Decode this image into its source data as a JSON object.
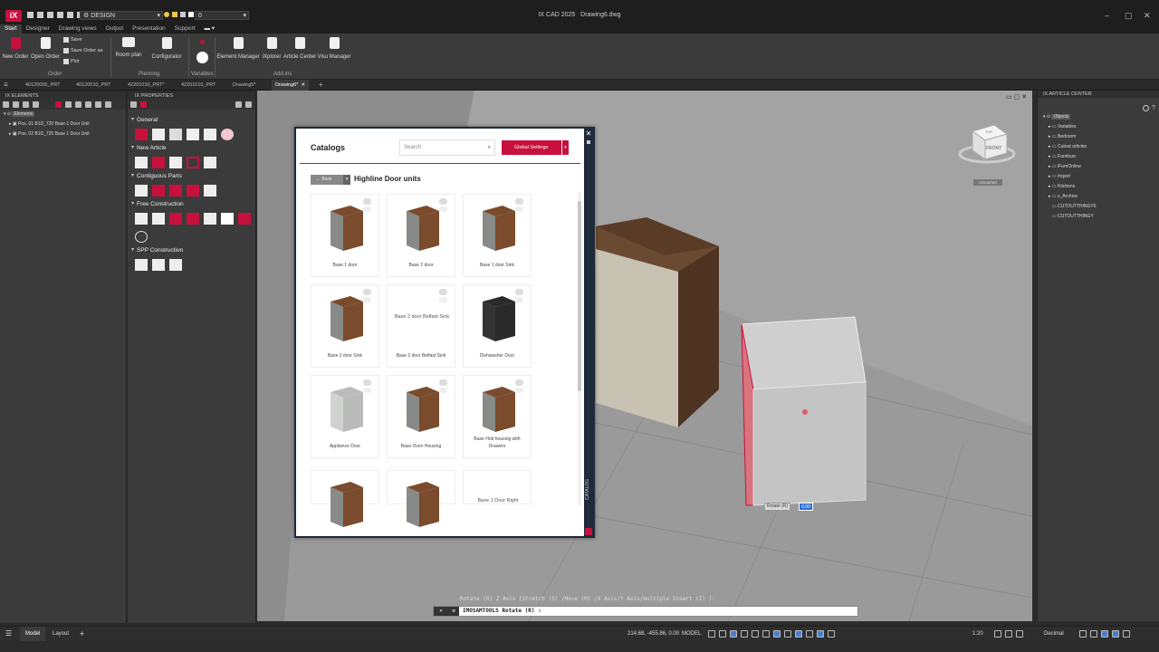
{
  "app": {
    "title": "IX CAD 2025",
    "document": "Drawing6.dwg",
    "workspace": "DESIGN",
    "layer": "0"
  },
  "ribbon_tabs": [
    "Start",
    "Designer",
    "Drawing views",
    "Output",
    "Presentation",
    "Support"
  ],
  "ribbon": {
    "new_order": "New Order",
    "open_order": "Open Order",
    "save": "Save",
    "save_order_as": "Save Order as",
    "plot": "Plot",
    "room_plan": "Room plan",
    "configurator": "Configurator",
    "element_manager": "Element Manager",
    "ixplorer": "iXplorer",
    "article_center": "Article Center",
    "visu_manager": "Visu Manager",
    "groups": {
      "order": "Order",
      "planning": "Planning",
      "variables": "Variables",
      "addins": "Add-ins"
    }
  },
  "doc_tabs": [
    "40120000_PRT",
    "40120010_PRT",
    "42201010_PRT*",
    "42201010_PRT",
    "Drawing5*",
    "Drawing6*"
  ],
  "elements_panel": {
    "title": "IX ELEMENTS",
    "root": "Elements",
    "items": [
      "Pos. 01 B1D_720 Base 1 Door Unit",
      "Pos. 02 B1D_720 Base 1 Door Unit"
    ]
  },
  "properties_panel": {
    "title": "IX PROPERTIES",
    "sections": [
      "General",
      "New Article",
      "Contiguous Parts",
      "Free Construction",
      "SPP Construction"
    ]
  },
  "article_center": {
    "title": "IX ARTICLE CENTER",
    "root": "Objects",
    "items": [
      "Variables",
      "Bedroom",
      "Cutout articles",
      "Furniture",
      "iFurnOnline",
      "Import",
      "Kitchens",
      "z_Archive",
      "CUTOUTTHINGY6",
      "CUTOUTTHINGY"
    ]
  },
  "catalog": {
    "title": "Catalogs",
    "search_placeholder": "Search",
    "global_settings": "Global Settings",
    "back": "Back",
    "subtitle": "Highline Door units",
    "side_label": "CATALOG",
    "items": [
      {
        "label": "Base 1 door",
        "broken": ""
      },
      {
        "label": "Base 2 door",
        "broken": ""
      },
      {
        "label": "Base 1 door Sink",
        "broken": ""
      },
      {
        "label": "Base 2 door Sink",
        "broken": ""
      },
      {
        "label": "Base 2 door Belfast Sink",
        "broken": "Base 2 door Belfast Sink"
      },
      {
        "label": "Dishwasher Door",
        "broken": ""
      },
      {
        "label": "Appliance Door",
        "broken": ""
      },
      {
        "label": "Base Oven Housing",
        "broken": ""
      },
      {
        "label": "Base Hob housing with Drawers",
        "broken": ""
      },
      {
        "label": "",
        "broken": ""
      },
      {
        "label": "",
        "broken": ""
      },
      {
        "label": "",
        "broken": "Base 1 Door Right"
      }
    ]
  },
  "viewport": {
    "viewcube_face": "FRONT",
    "viewcube_top": "TOP",
    "unnamed": "Unnamed",
    "rotate_tooltip": "Rotate (R)",
    "rotate_value": "0.00"
  },
  "command": {
    "history": "Rotate (R)  Z Axis [Stretch (S) /Move (M) /X Axis/Y Axis/multiple Insert (I)  ]:",
    "input": "IMOSAMTOOLS Rotate (R) :"
  },
  "statusbar": {
    "model_tab": "Model",
    "layout_tab": "Layout",
    "coords": "214.68, -455.86, 0.00",
    "space": "MODEL",
    "scale": "1:20",
    "units": "Decimal"
  },
  "colors": {
    "accent": "#c8103c",
    "panel": "#3b3b3b",
    "dark": "#1e1e1e"
  }
}
